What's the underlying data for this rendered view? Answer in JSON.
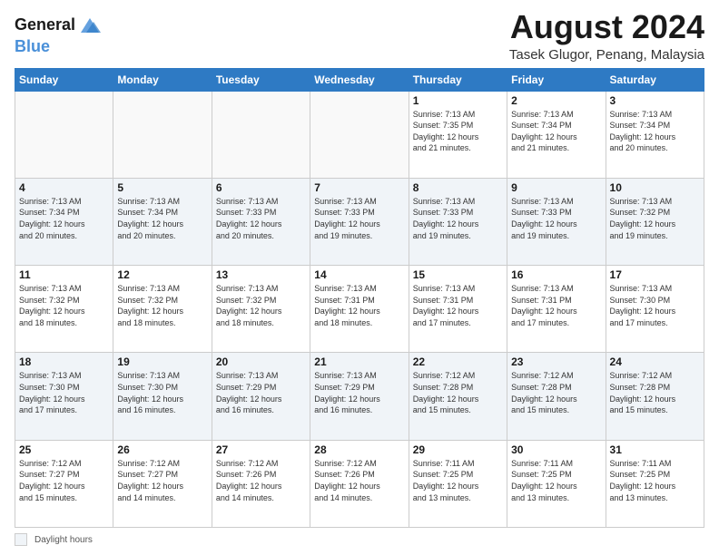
{
  "header": {
    "logo_line1": "General",
    "logo_line2": "Blue",
    "title": "August 2024",
    "subtitle": "Tasek Glugor, Penang, Malaysia"
  },
  "calendar": {
    "days_of_week": [
      "Sunday",
      "Monday",
      "Tuesday",
      "Wednesday",
      "Thursday",
      "Friday",
      "Saturday"
    ],
    "weeks": [
      [
        {
          "day": "",
          "info": ""
        },
        {
          "day": "",
          "info": ""
        },
        {
          "day": "",
          "info": ""
        },
        {
          "day": "",
          "info": ""
        },
        {
          "day": "1",
          "info": "Sunrise: 7:13 AM\nSunset: 7:35 PM\nDaylight: 12 hours\nand 21 minutes."
        },
        {
          "day": "2",
          "info": "Sunrise: 7:13 AM\nSunset: 7:34 PM\nDaylight: 12 hours\nand 21 minutes."
        },
        {
          "day": "3",
          "info": "Sunrise: 7:13 AM\nSunset: 7:34 PM\nDaylight: 12 hours\nand 20 minutes."
        }
      ],
      [
        {
          "day": "4",
          "info": "Sunrise: 7:13 AM\nSunset: 7:34 PM\nDaylight: 12 hours\nand 20 minutes."
        },
        {
          "day": "5",
          "info": "Sunrise: 7:13 AM\nSunset: 7:34 PM\nDaylight: 12 hours\nand 20 minutes."
        },
        {
          "day": "6",
          "info": "Sunrise: 7:13 AM\nSunset: 7:33 PM\nDaylight: 12 hours\nand 20 minutes."
        },
        {
          "day": "7",
          "info": "Sunrise: 7:13 AM\nSunset: 7:33 PM\nDaylight: 12 hours\nand 19 minutes."
        },
        {
          "day": "8",
          "info": "Sunrise: 7:13 AM\nSunset: 7:33 PM\nDaylight: 12 hours\nand 19 minutes."
        },
        {
          "day": "9",
          "info": "Sunrise: 7:13 AM\nSunset: 7:33 PM\nDaylight: 12 hours\nand 19 minutes."
        },
        {
          "day": "10",
          "info": "Sunrise: 7:13 AM\nSunset: 7:32 PM\nDaylight: 12 hours\nand 19 minutes."
        }
      ],
      [
        {
          "day": "11",
          "info": "Sunrise: 7:13 AM\nSunset: 7:32 PM\nDaylight: 12 hours\nand 18 minutes."
        },
        {
          "day": "12",
          "info": "Sunrise: 7:13 AM\nSunset: 7:32 PM\nDaylight: 12 hours\nand 18 minutes."
        },
        {
          "day": "13",
          "info": "Sunrise: 7:13 AM\nSunset: 7:32 PM\nDaylight: 12 hours\nand 18 minutes."
        },
        {
          "day": "14",
          "info": "Sunrise: 7:13 AM\nSunset: 7:31 PM\nDaylight: 12 hours\nand 18 minutes."
        },
        {
          "day": "15",
          "info": "Sunrise: 7:13 AM\nSunset: 7:31 PM\nDaylight: 12 hours\nand 17 minutes."
        },
        {
          "day": "16",
          "info": "Sunrise: 7:13 AM\nSunset: 7:31 PM\nDaylight: 12 hours\nand 17 minutes."
        },
        {
          "day": "17",
          "info": "Sunrise: 7:13 AM\nSunset: 7:30 PM\nDaylight: 12 hours\nand 17 minutes."
        }
      ],
      [
        {
          "day": "18",
          "info": "Sunrise: 7:13 AM\nSunset: 7:30 PM\nDaylight: 12 hours\nand 17 minutes."
        },
        {
          "day": "19",
          "info": "Sunrise: 7:13 AM\nSunset: 7:30 PM\nDaylight: 12 hours\nand 16 minutes."
        },
        {
          "day": "20",
          "info": "Sunrise: 7:13 AM\nSunset: 7:29 PM\nDaylight: 12 hours\nand 16 minutes."
        },
        {
          "day": "21",
          "info": "Sunrise: 7:13 AM\nSunset: 7:29 PM\nDaylight: 12 hours\nand 16 minutes."
        },
        {
          "day": "22",
          "info": "Sunrise: 7:12 AM\nSunset: 7:28 PM\nDaylight: 12 hours\nand 15 minutes."
        },
        {
          "day": "23",
          "info": "Sunrise: 7:12 AM\nSunset: 7:28 PM\nDaylight: 12 hours\nand 15 minutes."
        },
        {
          "day": "24",
          "info": "Sunrise: 7:12 AM\nSunset: 7:28 PM\nDaylight: 12 hours\nand 15 minutes."
        }
      ],
      [
        {
          "day": "25",
          "info": "Sunrise: 7:12 AM\nSunset: 7:27 PM\nDaylight: 12 hours\nand 15 minutes."
        },
        {
          "day": "26",
          "info": "Sunrise: 7:12 AM\nSunset: 7:27 PM\nDaylight: 12 hours\nand 14 minutes."
        },
        {
          "day": "27",
          "info": "Sunrise: 7:12 AM\nSunset: 7:26 PM\nDaylight: 12 hours\nand 14 minutes."
        },
        {
          "day": "28",
          "info": "Sunrise: 7:12 AM\nSunset: 7:26 PM\nDaylight: 12 hours\nand 14 minutes."
        },
        {
          "day": "29",
          "info": "Sunrise: 7:11 AM\nSunset: 7:25 PM\nDaylight: 12 hours\nand 13 minutes."
        },
        {
          "day": "30",
          "info": "Sunrise: 7:11 AM\nSunset: 7:25 PM\nDaylight: 12 hours\nand 13 minutes."
        },
        {
          "day": "31",
          "info": "Sunrise: 7:11 AM\nSunset: 7:25 PM\nDaylight: 12 hours\nand 13 minutes."
        }
      ]
    ]
  },
  "footer": {
    "legend_label": "Daylight hours"
  }
}
